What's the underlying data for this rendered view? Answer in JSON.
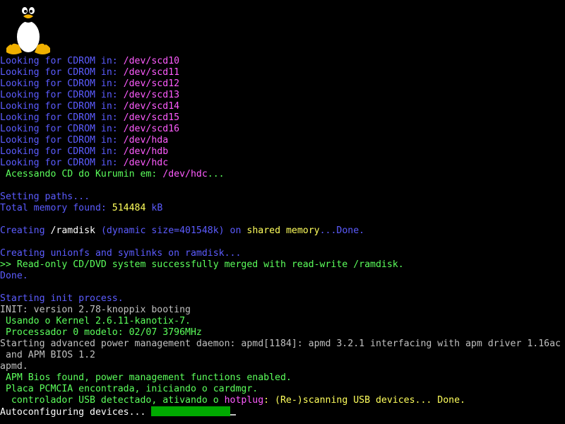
{
  "logo": {
    "icon": "tux-penguin-icon"
  },
  "colors": {
    "background": "#000000",
    "blue": "#5c5cff",
    "magenta": "#ff5cff",
    "green": "#5cff5c",
    "yellow": "#ffff5c",
    "gray": "#c0c0c0",
    "progress": "#00aa00"
  },
  "cdrom_scan": {
    "prefix": "Looking for CDROM in: ",
    "devices": [
      "/dev/scd10",
      "/dev/scd11",
      "/dev/scd12",
      "/dev/scd13",
      "/dev/scd14",
      "/dev/scd15",
      "/dev/scd16",
      "/dev/hda",
      "/dev/hdb",
      "/dev/hdc"
    ]
  },
  "accessing": {
    "text": " Acessando CD do Kurumin em: ",
    "device": "/dev/hdc",
    "dots": "..."
  },
  "paths": {
    "setting": "Setting paths...",
    "memory_label": "Total memory found: ",
    "memory_value": "514484",
    "memory_unit": " kB"
  },
  "ramdisk": {
    "creating": "Creating ",
    "path": "/ramdisk",
    "dynamic": " (dynamic size=401548k) on ",
    "shared": "shared memory",
    "done": "...Done."
  },
  "unionfs": {
    "creating": "Creating unionfs and symlinks on ramdisk...",
    "merged": ">> Read-only CD/DVD system successfully merged with read-write /ramdisk.",
    "done": "Done."
  },
  "init": {
    "starting": "Starting init process.",
    "version": "INIT: version 2.78-knoppix booting",
    "kernel": " Usando o Kernel 2.6.11-kanotix-7.",
    "cpu": " Processador 0 modelo: 02/07 3796MHz",
    "apmd1": "Starting advanced power management daemon: apmd[1184]: apmd 3.2.1 interfacing with apm driver 1.16ac",
    "apmd2": " and APM BIOS 1.2",
    "apmd3": "apmd.",
    "apm_found": " APM Bios found, power management functions enabled.",
    "pcmcia": " Placa PCMCIA encontrada, iniciando o cardmgr.",
    "usb_prefix": "  controlador USB detectado, ativando o ",
    "hotplug": "hotplug",
    "usb_suffix": ": (Re-)scanning USB devices... Done.",
    "autoconfig": "Autoconfiguring devices... "
  },
  "progress": {
    "value": 0.5
  }
}
